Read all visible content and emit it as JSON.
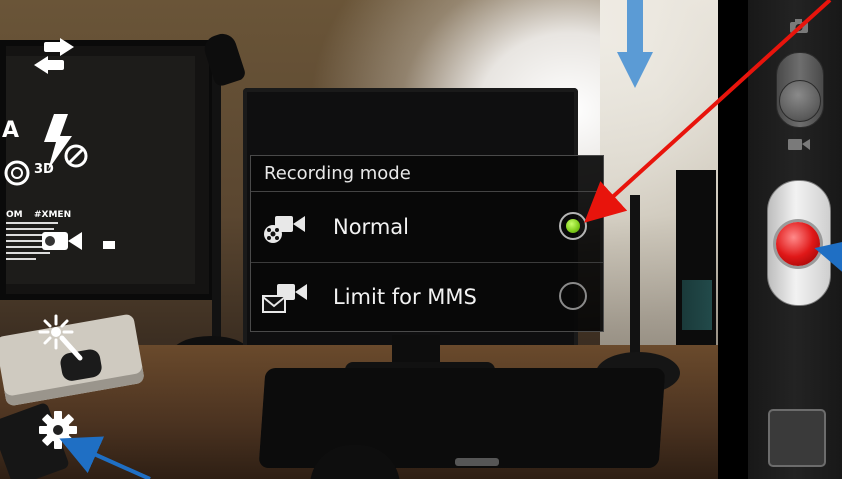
{
  "dialog": {
    "title": "Recording mode",
    "options": [
      {
        "label": "Normal",
        "icon": "video-camera-reel-icon",
        "selected": true
      },
      {
        "label": "Limit for MMS",
        "icon": "video-camera-envelope-icon",
        "selected": false
      }
    ]
  },
  "left_overlay": {
    "screen_text": [
      "A",
      "3D",
      "OM",
      "#XMEN"
    ],
    "icons": [
      "switch-camera-icon",
      "flash-off-icon",
      "settings-wand-icon",
      "gear-icon"
    ]
  },
  "right_panel": {
    "icons": [
      "camera-icon",
      "video-icon"
    ],
    "mode_switch": "camera/video",
    "record_button": "record",
    "thumbnail": "gallery-thumbnail"
  },
  "colors": {
    "radio_selected": "#7ecb1a",
    "record_red": "#e01818",
    "arrow_red": "#e8140c",
    "arrow_blue": "#5b9bd5"
  }
}
